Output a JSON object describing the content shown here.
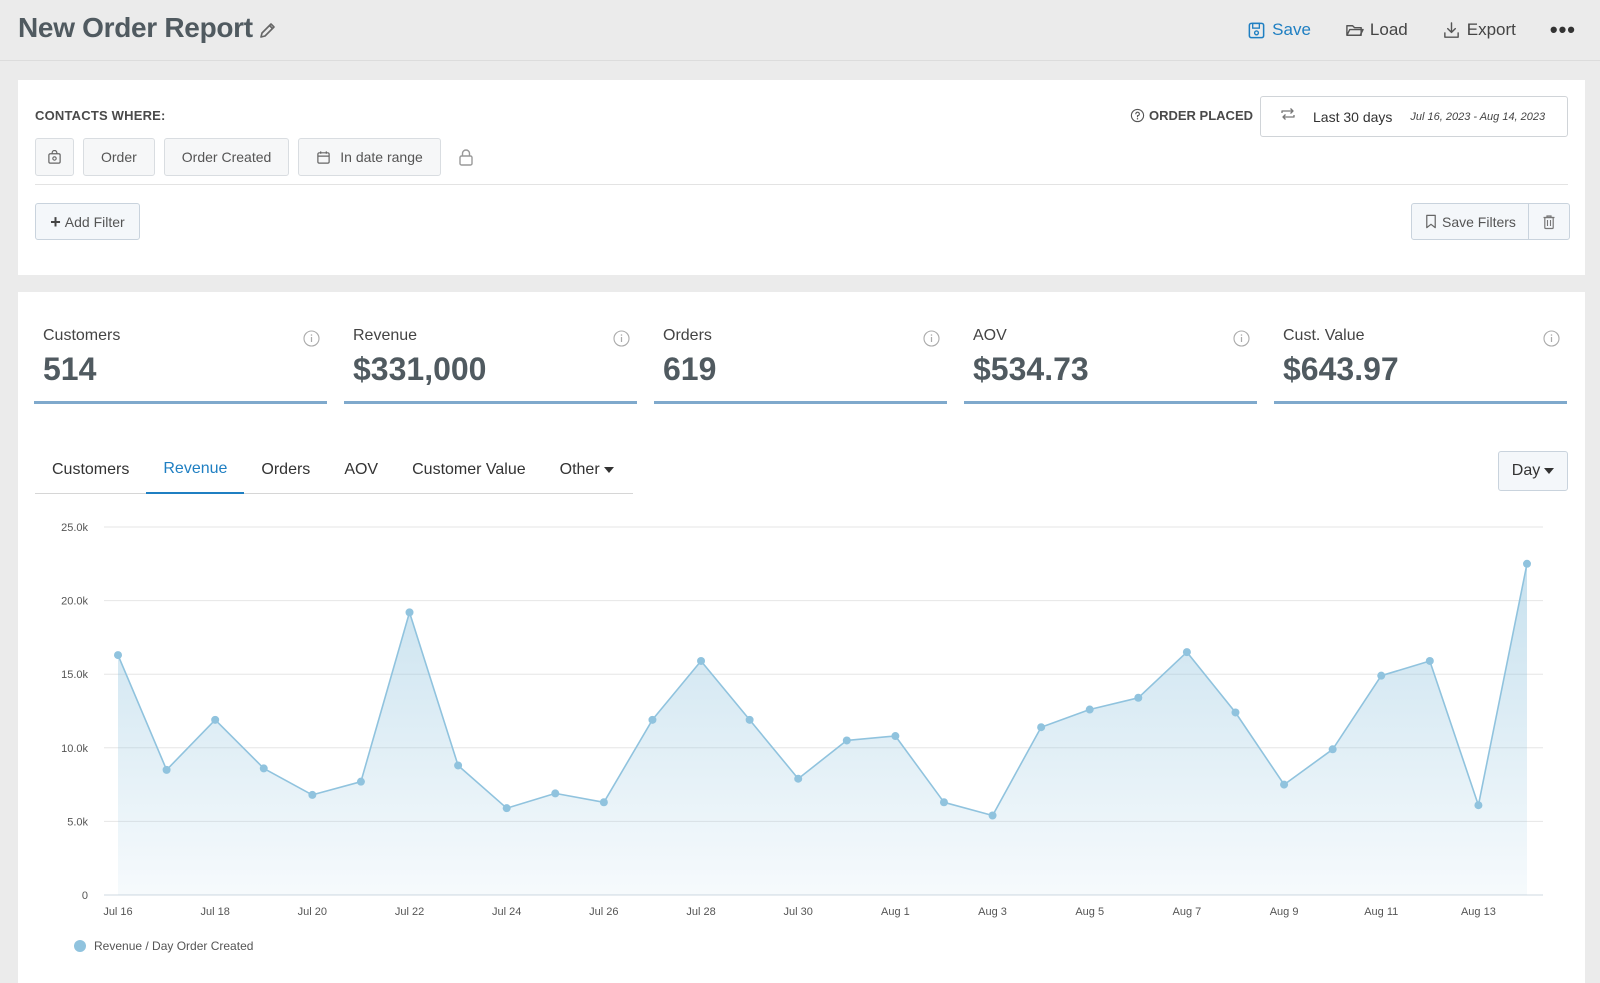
{
  "header": {
    "title": "New Order Report",
    "actions": {
      "save": "Save",
      "load": "Load",
      "export": "Export",
      "more": "•••"
    }
  },
  "filters": {
    "contacts_where": "CONTACTS WHERE:",
    "chips": [
      "Order",
      "Order Created",
      "In date range"
    ],
    "order_placed_label": "ORDER PLACED",
    "date_label": "Last 30 days",
    "date_range": "Jul 16, 2023 - Aug 14, 2023",
    "add_filter": "Add Filter",
    "save_filters": "Save Filters"
  },
  "kpis": [
    {
      "label": "Customers",
      "value": "514"
    },
    {
      "label": "Revenue",
      "value": "$331,000"
    },
    {
      "label": "Orders",
      "value": "619"
    },
    {
      "label": "AOV",
      "value": "$534.73"
    },
    {
      "label": "Cust. Value",
      "value": "$643.97"
    }
  ],
  "tabs": [
    "Customers",
    "Revenue",
    "Orders",
    "AOV",
    "Customer Value",
    "Other"
  ],
  "active_tab": "Revenue",
  "interval": "Day",
  "colors": {
    "accent": "#1f7fc2",
    "series": "#90c3de",
    "kpi_underline": "#7fa9cc"
  },
  "chart_data": {
    "type": "area",
    "y_ticks": [
      "0",
      "5.0k",
      "10.0k",
      "15.0k",
      "20.0k",
      "25.0k"
    ],
    "ylim": [
      0,
      25000
    ],
    "x": [
      "Jul 16",
      "Jul 17",
      "Jul 18",
      "Jul 19",
      "Jul 20",
      "Jul 21",
      "Jul 22",
      "Jul 23",
      "Jul 24",
      "Jul 25",
      "Jul 26",
      "Jul 27",
      "Jul 28",
      "Jul 29",
      "Jul 30",
      "Jul 31",
      "Aug 1",
      "Aug 2",
      "Aug 3",
      "Aug 4",
      "Aug 5",
      "Aug 6",
      "Aug 7",
      "Aug 8",
      "Aug 9",
      "Aug 10",
      "Aug 11",
      "Aug 12",
      "Aug 13",
      "Aug 14"
    ],
    "x_tick_labels": [
      "Jul 16",
      "Jul 18",
      "Jul 20",
      "Jul 22",
      "Jul 24",
      "Jul 26",
      "Jul 28",
      "Jul 30",
      "Aug 1",
      "Aug 3",
      "Aug 5",
      "Aug 7",
      "Aug 9",
      "Aug 11",
      "Aug 13"
    ],
    "series": [
      {
        "name": "Revenue / Day Order Created",
        "values": [
          16300,
          8500,
          11900,
          8600,
          6800,
          7700,
          19200,
          8800,
          5900,
          6900,
          6300,
          11900,
          15900,
          11900,
          7900,
          10500,
          10800,
          6300,
          5400,
          11400,
          12600,
          13400,
          16500,
          12400,
          7500,
          9900,
          14900,
          15900,
          6100,
          22500
        ]
      }
    ],
    "grid": true,
    "legend": "bottom-left"
  }
}
